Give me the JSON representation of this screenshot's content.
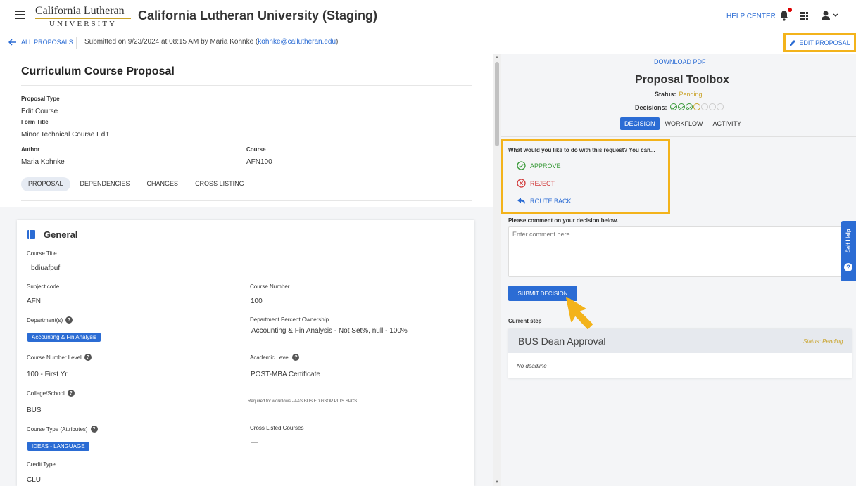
{
  "header": {
    "logo_top": "California Lutheran",
    "logo_bottom": "UNIVERSITY",
    "app_title": "California Lutheran University (Staging)",
    "help_center": "HELP CENTER"
  },
  "subbar": {
    "back_label": "ALL PROPOSALS",
    "submitted_prefix": "Submitted on 9/23/2024 at 08:15 AM by Maria Kohnke (",
    "email": "kohnke@callutheran.edu",
    "submitted_suffix": ")",
    "edit_label": "EDIT PROPOSAL"
  },
  "proposal": {
    "title": "Curriculum Course Proposal",
    "proposal_type_label": "Proposal Type",
    "proposal_type": "Edit Course",
    "form_title_label": "Form Title",
    "form_title": "Minor Technical Course Edit",
    "author_label": "Author",
    "author": "Maria Kohnke",
    "course_label": "Course",
    "course": "AFN100",
    "tabs": [
      "PROPOSAL",
      "DEPENDENCIES",
      "CHANGES",
      "CROSS LISTING"
    ]
  },
  "general": {
    "title": "General",
    "course_title_label": "Course Title",
    "course_title": "bdiuafpuf",
    "subject_code_label": "Subject code",
    "subject_code": "AFN",
    "course_number_label": "Course Number",
    "course_number": "100",
    "departments_label": "Department(s)",
    "department_chip": "Accounting & Fin Analysis",
    "dept_percent_label": "Department Percent Ownership",
    "dept_percent": "Accounting & Fin Analysis - Not Set%, null - 100%",
    "course_number_level_label": "Course Number Level",
    "course_number_level": "100 - First Yr",
    "academic_level_label": "Academic Level",
    "academic_level": "POST-MBA Certificate",
    "college_label": "College/School",
    "college": "BUS",
    "required_note": "Required for workflows - A&S BUS ED GSOP PLTS SPCS",
    "course_type_label": "Course Type (Attributes)",
    "course_type_chip": "IDEAS - LANGUAGE",
    "cross_listed_label": "Cross Listed Courses",
    "cross_listed": "—",
    "credit_type_label": "Credit Type",
    "credit_type": "CLU"
  },
  "toolbox": {
    "download_pdf": "DOWNLOAD PDF",
    "title": "Proposal Toolbox",
    "status_label": "Status:",
    "status_value": "Pending",
    "decisions_label": "Decisions:",
    "decisions_done": 3,
    "decisions_total": 7,
    "tabs": [
      "DECISION",
      "WORKFLOW",
      "ACTIVITY"
    ],
    "question": "What would you like to do with this request? You can...",
    "approve": "APPROVE",
    "reject": "REJECT",
    "route_back": "ROUTE BACK",
    "comment_label": "Please comment on your decision below.",
    "comment_placeholder": "Enter comment here",
    "submit_label": "SUBMIT DECISION",
    "current_step_label": "Current step",
    "step_title": "BUS Dean Approval",
    "step_status": "Status: Pending",
    "step_deadline": "No deadline",
    "self_help": "Self Help"
  },
  "colors": {
    "accent": "#2b6cd4",
    "highlight": "#f3b31b",
    "approve": "#3a9a3a",
    "reject": "#d23c3c",
    "pending": "#c9a227"
  }
}
